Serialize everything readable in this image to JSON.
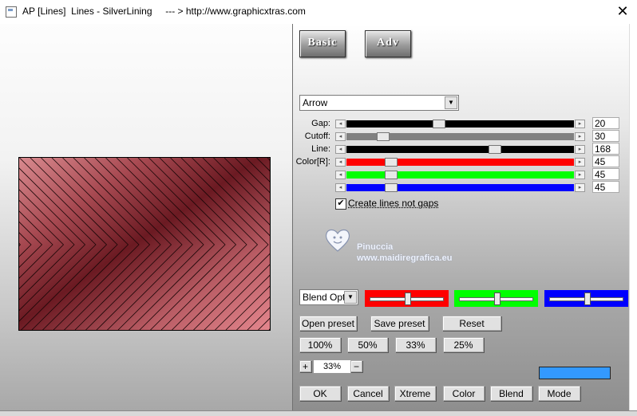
{
  "window": {
    "title": "AP [Lines]  Lines - SilverLining     --- > http://www.graphicxtras.com",
    "close_glyph": "✕"
  },
  "modes": {
    "basic": "Basic",
    "adv": "Adv"
  },
  "style_select": {
    "value": "Arrow"
  },
  "sliders": [
    {
      "label": "Gap:",
      "value": "20",
      "color": "#000000",
      "fraction": 0.4
    },
    {
      "label": "Cutoff:",
      "value": "30",
      "color": "#808080",
      "fraction": 0.14
    },
    {
      "label": "Line:",
      "value": "168",
      "color": "#000000",
      "fraction": 0.66
    },
    {
      "label": "Color[R]:",
      "value": "45",
      "color": "#ff0000",
      "fraction": 0.18
    },
    {
      "label": "",
      "value": "45",
      "color": "#00ff00",
      "fraction": 0.18
    },
    {
      "label": "",
      "value": "45",
      "color": "#0000ff",
      "fraction": 0.18
    }
  ],
  "checkbox": {
    "label": "Create lines not gaps",
    "checked": true,
    "mark": "✔"
  },
  "watermark": {
    "line1": "Pinuccia",
    "line2": "www.maidiregrafica.eu"
  },
  "blend": {
    "select_value": "Blend Optio",
    "swatches": [
      {
        "color": "#ff0000",
        "level": 0.5
      },
      {
        "color": "#00ff00",
        "level": 0.5
      },
      {
        "color": "#0000ff",
        "level": 0.5
      }
    ]
  },
  "preset_buttons": {
    "open": "Open preset",
    "save": "Save preset",
    "reset": "Reset"
  },
  "zoom_buttons": [
    "100%",
    "50%",
    "33%",
    "25%"
  ],
  "zoom": {
    "plus": "+",
    "value": "33%",
    "minus": "−"
  },
  "bottom_buttons": {
    "ok": "OK",
    "cancel": "Cancel",
    "xtreme": "Xtreme",
    "color": "Color",
    "blend": "Blend",
    "mode": "Mode"
  },
  "accent_color": "#3399ff"
}
